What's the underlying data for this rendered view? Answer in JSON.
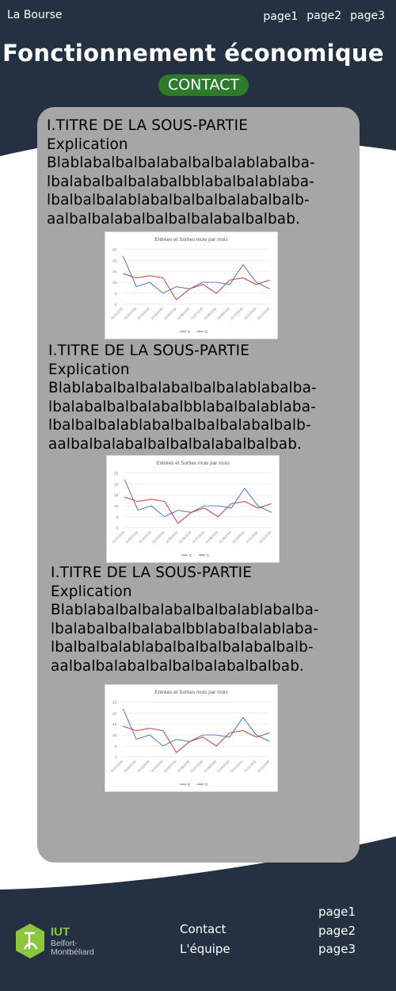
{
  "header": {
    "brand": "La Bourse",
    "nav": [
      "page1",
      "page2",
      "page3"
    ],
    "title": "Fonctionnement économique",
    "contact_button": "CONTACT"
  },
  "sections": [
    {
      "heading": "I.TITRE DE LA SOUS-PARTIE",
      "subheading": "Explication",
      "lines": [
        "Blablabalbalbalabalbalbalablabalba-",
        "lbalabalbalbalabalbblabalbalablaba-",
        "lbalbalbalablabalbalbalbalabalbalb-",
        "aalbalbalabalbalbalbalabalbalbab."
      ]
    },
    {
      "heading": "I.TITRE DE LA SOUS-PARTIE",
      "subheading": "Explication",
      "lines": [
        "Blablabalbalbalabalbalbalablabalba-",
        "lbalabalbalbalabalbblabalbalablaba-",
        "lbalbalbalablabalbalbalbalabalbalb-",
        "aalbalbalabalbalbalbalabalbalbab."
      ]
    },
    {
      "heading": "I.TITRE DE LA SOUS-PARTIE",
      "subheading": "Explication",
      "lines": [
        "Blablabalbalbalabalbalbalablabalba-",
        "lbalabalbalbalabalbblabalbalablaba-",
        "lbalbalbalablabalbalbalbalabalbalb-",
        "aalbalbalabalbalbalbalabalbalbab."
      ]
    }
  ],
  "chart_data": {
    "type": "line",
    "title": "Entrées et Sorties mois par mois",
    "categories": [
      "01/01/2018",
      "01/02/2018",
      "01/03/2018",
      "01/04/2018",
      "01/05/2018",
      "01/06/2018",
      "01/07/2018",
      "01/08/2018",
      "01/09/2018",
      "01/10/2018",
      "01/11/2018",
      "01/12/2018"
    ],
    "series": [
      {
        "name": "E",
        "color": "#4472c4",
        "values": [
          22,
          8,
          10,
          5,
          8,
          7,
          10,
          10,
          9,
          18,
          10,
          7
        ]
      },
      {
        "name": "S",
        "color": "#c0393b",
        "values": [
          14,
          12,
          13,
          12,
          2,
          7,
          9,
          5,
          11,
          12,
          9,
          11
        ]
      }
    ],
    "yticks": [
      "0",
      "5",
      "10",
      "15",
      "20",
      "25"
    ],
    "ylim": [
      0,
      25
    ]
  },
  "footer": {
    "logo_text": [
      "IUT",
      "Belfort-",
      "Montbéliard"
    ],
    "links_mid": [
      "Contact",
      "L'équipe"
    ],
    "links_right": [
      "page1",
      "page2",
      "page3"
    ]
  },
  "colors": {
    "dark": "#233140",
    "card": "#a6a6a6",
    "accent_green": "#2d7a2a",
    "logo_green": "#8cc63f"
  }
}
